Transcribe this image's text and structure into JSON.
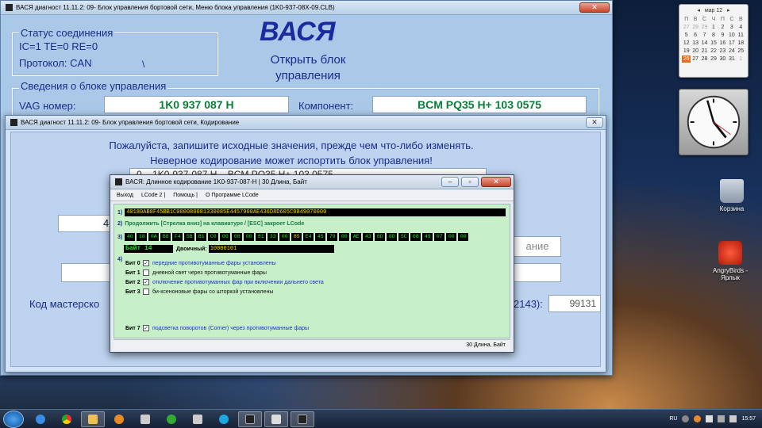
{
  "main_window": {
    "title": "ВАСЯ диагност 11.11.2: 09- Блок управления бортовой сети,  Меню блока управления (1K0-937-08X-09.CLB)",
    "conn_status_label": "Статус соединения",
    "conn_values": "IC=1  TE=0   RE=0",
    "protocol": "Протокол: CAN",
    "protocol_spinner": "\\",
    "logo": "ВАСЯ",
    "open_block_label": "Открыть блок управления",
    "info_header": "Сведения о блоке управления",
    "vag_label": "VAG номер:",
    "vag_value": "1K0 937 087 H",
    "component_label": "Компонент:",
    "component_value": "BCM PQ35  H+  103 0575"
  },
  "coding_window": {
    "title": "ВАСЯ диагност 11.11.2: 09- Блок управления бортовой сети,  Кодирование",
    "warning_line1": "Пожалуйста, запишите исходные значения, прежде чем что-либо изменять.",
    "warning_line2": "Неверное кодирование может испортить блок управления!",
    "field_partial": "0 – 1K0-937-087 H  – BCM PQ35  H+  103 0575",
    "left_partial": "40",
    "right_partial": "ание",
    "master_label": "Код мастерско",
    "code_suffix": "2143):",
    "code_value": "99131"
  },
  "lcode_window": {
    "title": "ВАСЯ: Длинное кодирование  1K0-937-087-H | 30 Длина, Байт",
    "menu": [
      "Выход",
      "LCode 2 |",
      "Помощь |",
      "О Программе LCode"
    ],
    "row1_num": "1)",
    "long_code": "40180AB8F45BB1C000080081330085E4457900AE436D8D605C0849070000",
    "row2_num": "2)",
    "hint": "Продолжить [Стрелка вниз] на клавиатуре / [ESC] закроет LCode",
    "row3_num": "3)",
    "bytes": [
      "40",
      "18",
      "0A",
      "B8",
      "F4",
      "5B",
      "B1",
      "C0",
      "00",
      "08",
      "00",
      "81",
      "33",
      "00",
      "85",
      "E4",
      "45",
      "79",
      "00",
      "AE",
      "43",
      "6D",
      "8D",
      "5C",
      "08",
      "49",
      "07",
      "00",
      "00"
    ],
    "selected_byte_index": 14,
    "byte_label": "Байт 14",
    "binary_label": "Двоичный:",
    "binary_value": "10000101",
    "row4_num": "4)",
    "bits": [
      {
        "label": "Бит 0",
        "checked": true,
        "text": "передние противотуманные фары установлены"
      },
      {
        "label": "Бит 1",
        "checked": false,
        "text": "дневной свет через противотуманные фары"
      },
      {
        "label": "Бит 2",
        "checked": true,
        "text": "отключение противотуманных фар при включении дальнего света"
      },
      {
        "label": "Бит 3",
        "checked": false,
        "text": "би-ксеноновые фары со шторкой установлены"
      }
    ],
    "bit7": {
      "label": "Бит 7",
      "checked": true,
      "text": "подсветка поворотов (Corner) через противотуманные фары"
    },
    "status": "30 Длина, Байт",
    "check_mark": "✓"
  },
  "calendar": {
    "month": "мар 12",
    "headers": [
      "П",
      "В",
      "С",
      "Ч",
      "П",
      "С",
      "В"
    ],
    "days": [
      "27",
      "28",
      "29",
      "1",
      "2",
      "3",
      "4",
      "5",
      "6",
      "7",
      "8",
      "9",
      "10",
      "11",
      "12",
      "13",
      "14",
      "15",
      "16",
      "17",
      "18",
      "19",
      "20",
      "21",
      "22",
      "23",
      "24",
      "25",
      "26",
      "27",
      "28",
      "29",
      "30",
      "31",
      "1"
    ],
    "today_index": 28
  },
  "desktop": {
    "recycle_label": "Корзина",
    "angry_label": "AngryBirds - Ярлык"
  },
  "tray": {
    "lang": "RU",
    "time": "15:57"
  }
}
